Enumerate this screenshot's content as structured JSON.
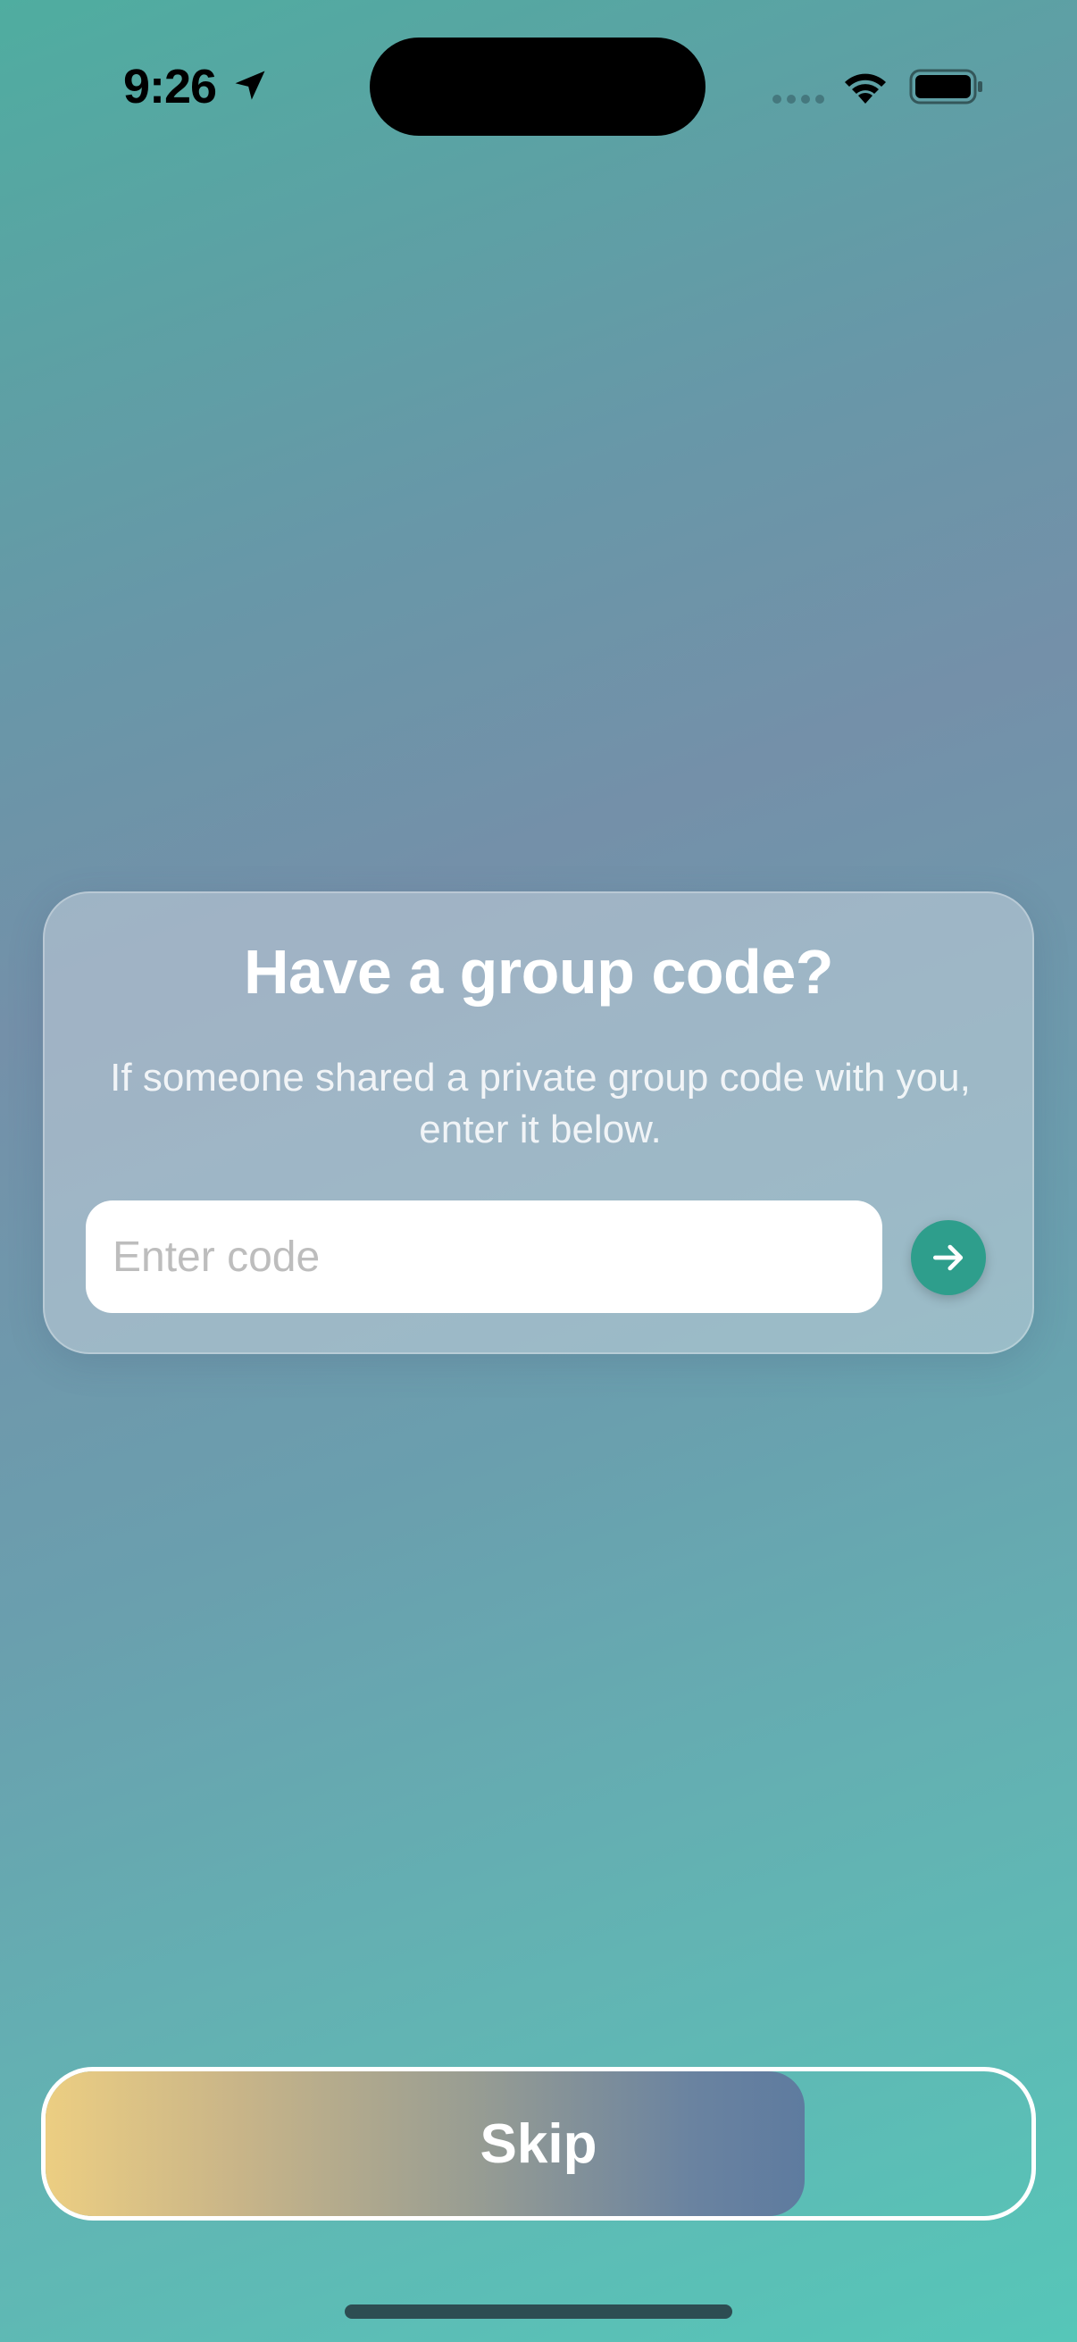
{
  "status_bar": {
    "time": "9:26",
    "icons": [
      "location-arrow-icon",
      "cellular-signal-icon",
      "wifi-icon",
      "battery-icon"
    ]
  },
  "card": {
    "title": "Have a group code?",
    "subtitle": "If someone shared a private group code with you, enter it below.",
    "input": {
      "value": "",
      "placeholder": "Enter code"
    },
    "submit_icon": "arrow-right-icon"
  },
  "skip": {
    "label": "Skip",
    "progress_fraction": 0.77
  },
  "colors": {
    "accent": "#2e9e8c",
    "skip_gradient_start": "#ecce82",
    "skip_gradient_end": "#5e7b9f",
    "background_top": "#4fada0",
    "background_bottom": "#56c6b8"
  }
}
